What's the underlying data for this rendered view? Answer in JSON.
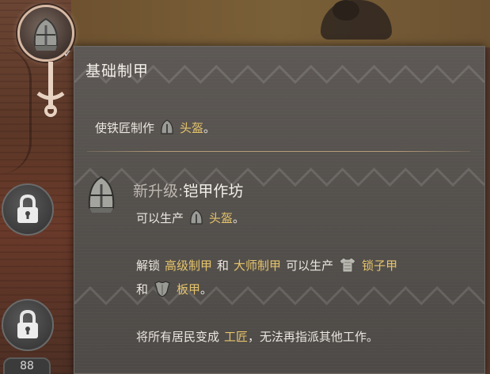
{
  "tooltip": {
    "title": "基础制甲",
    "requirement": {
      "prefix": "使铁匠制作",
      "item": "头盔",
      "suffix": "。"
    },
    "upgrade": {
      "label": "新升级:",
      "name": "铠甲作坊",
      "produce_prefix": "可以生产",
      "produce_item": "头盔",
      "produce_suffix": "。"
    },
    "unlock": {
      "prefix": "解锁",
      "tech1": "高级制甲",
      "and1": "和",
      "tech2": "大师制甲",
      "middle": "可以生产",
      "item1": "锁子甲",
      "and2": "和",
      "item2": "板甲",
      "suffix": "。"
    },
    "worker": {
      "prefix": "将所有居民变成",
      "role": "工匠",
      "suffix": "，无法再指派其他工作。"
    }
  },
  "tree": {
    "bottom_node_label": "88"
  },
  "colors": {
    "highlight": "#e6c46c",
    "text": "#ebe6df",
    "muted": "#bdb7b0",
    "panel": "#56514d"
  },
  "icons": [
    "helmet-icon",
    "check-icon",
    "lock-icon",
    "chainmail-icon",
    "plate-armor-icon"
  ]
}
